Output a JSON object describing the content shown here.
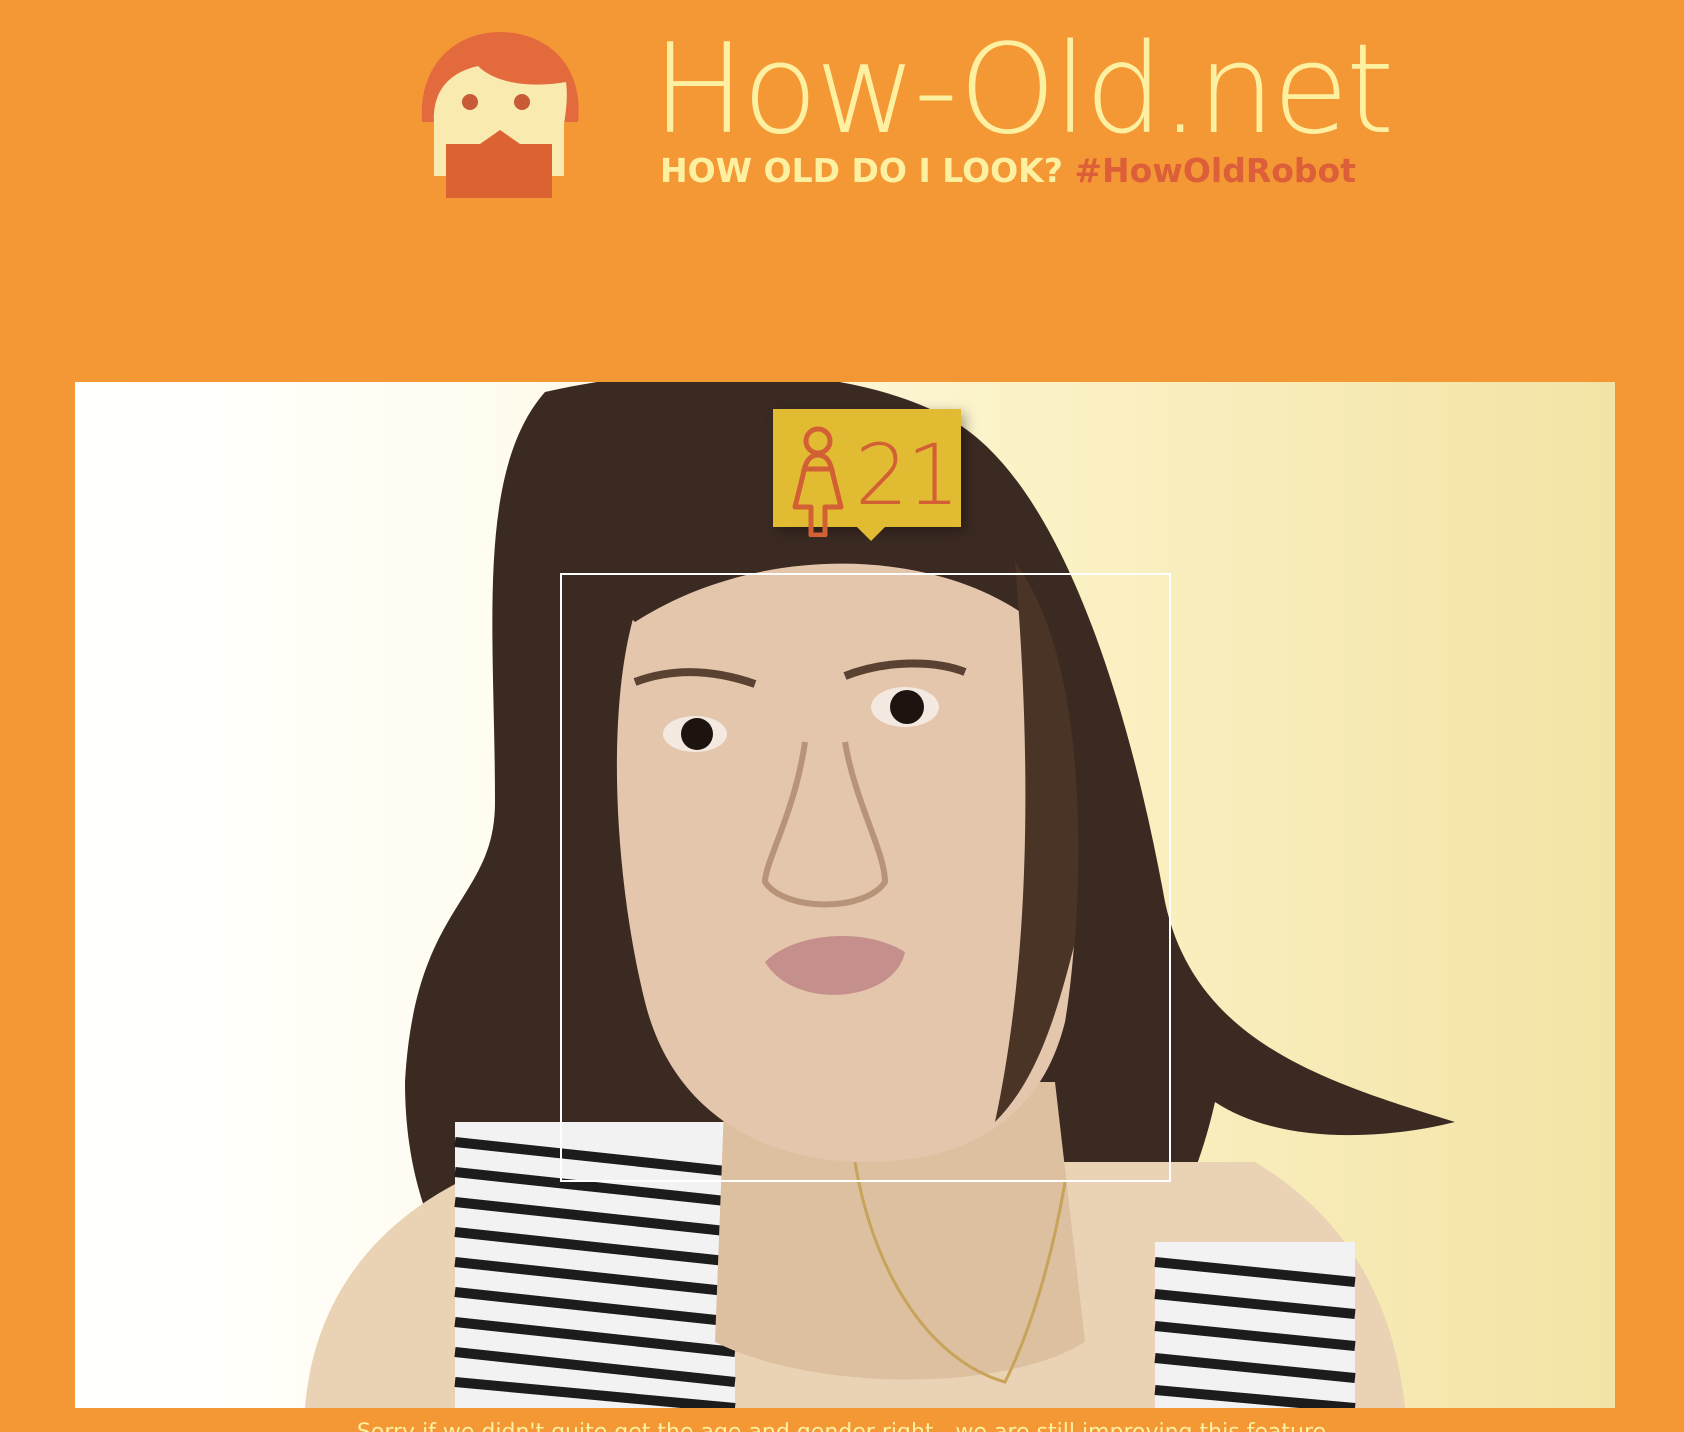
{
  "header": {
    "site_title": "How-Old.net",
    "tagline": "HOW OLD DO I LOOK?",
    "hashtag": "#HowOldRobot"
  },
  "result": {
    "gender": "female",
    "age": "21"
  },
  "icons": {
    "logo": "robot-face-logo-icon",
    "gender": "female-icon"
  },
  "colors": {
    "background": "#f49735",
    "title": "#fdf0a0",
    "hashtag": "#dc5f3a",
    "badge": "#e1bc32",
    "age_text": "#d35f35",
    "face_box": "#ffffff"
  },
  "footer": {
    "note": "Sorry if we didn't quite get the age and gender right - we are still improving this feature."
  }
}
